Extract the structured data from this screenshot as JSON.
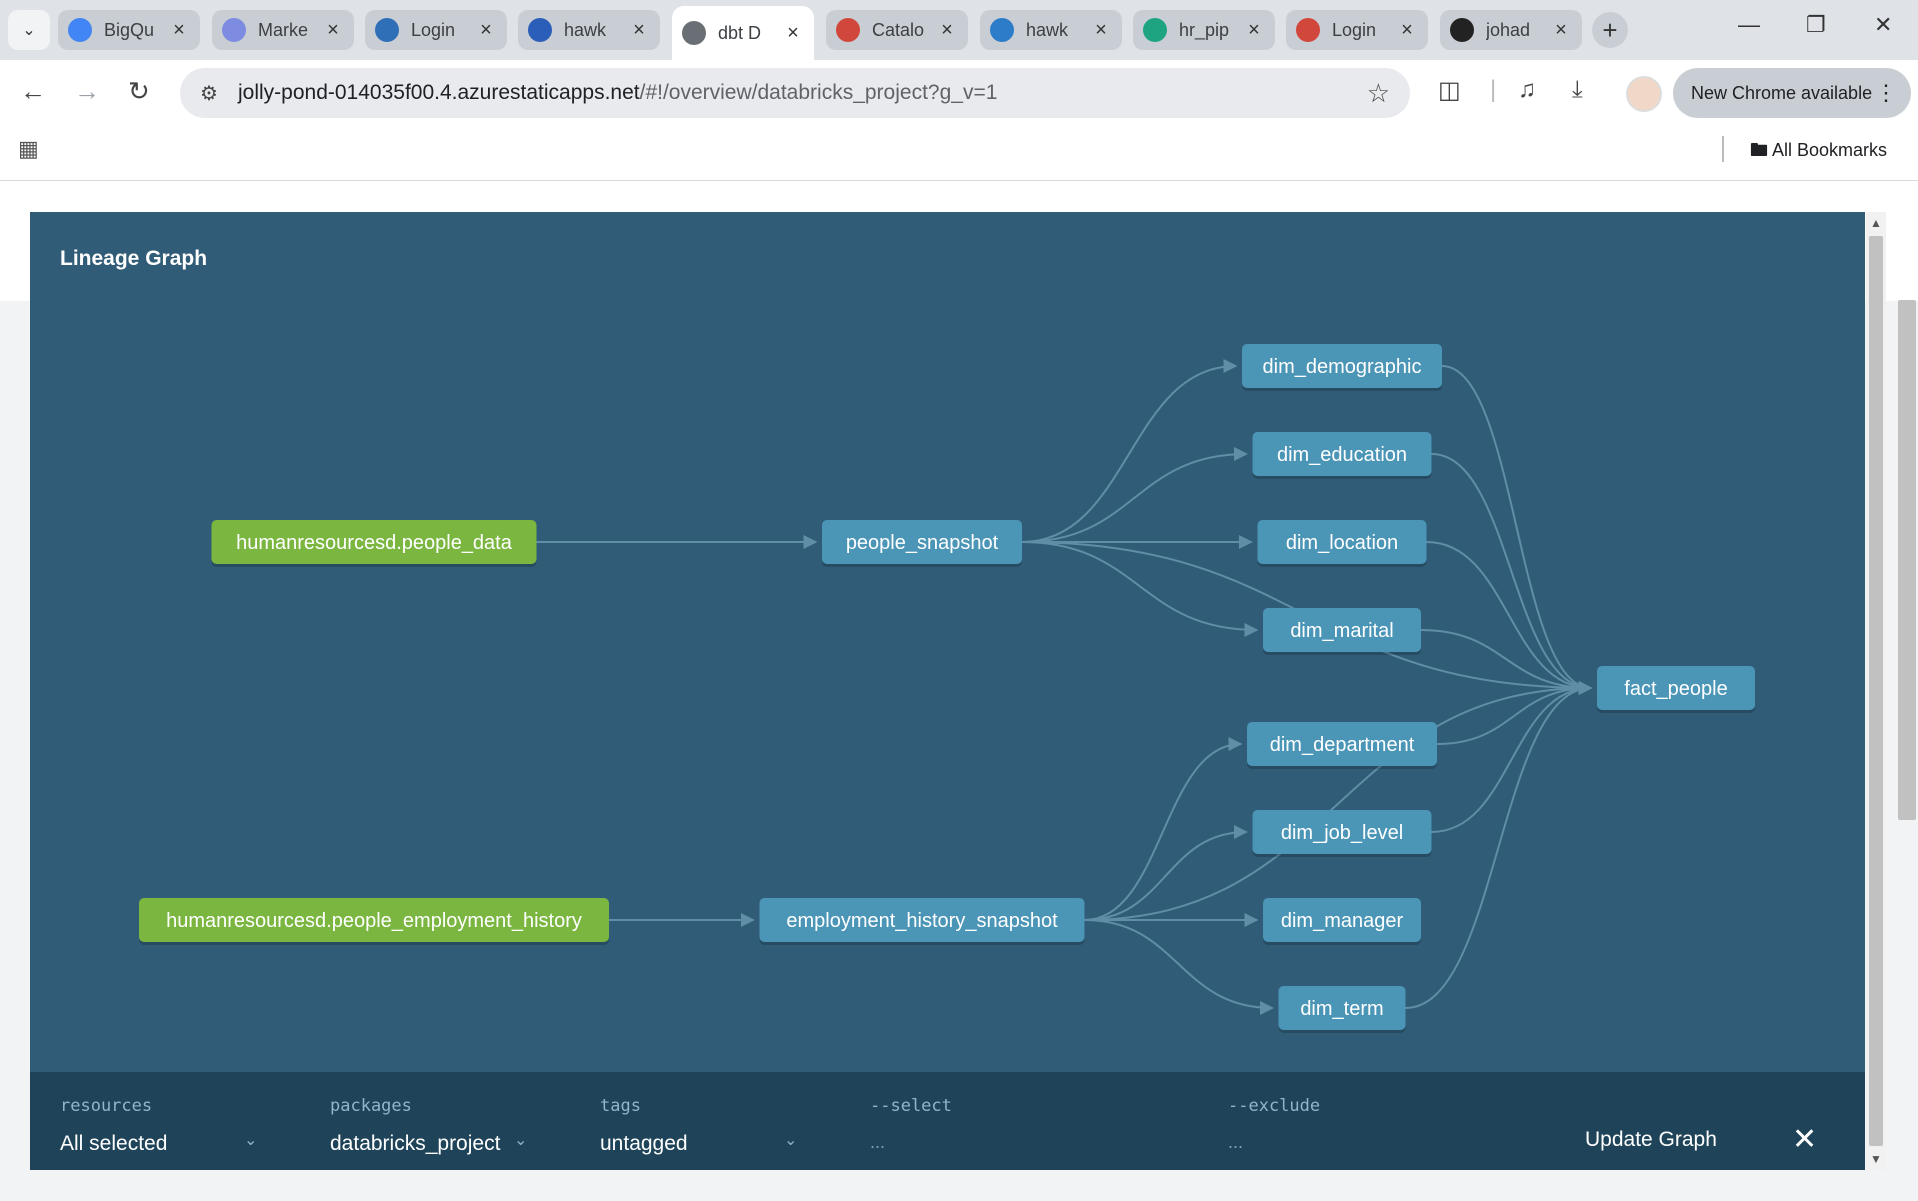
{
  "browser": {
    "tabs": [
      {
        "title": "BigQu",
        "icon": "bigquery-icon",
        "color": "#4285f4",
        "active": false
      },
      {
        "title": "Marke",
        "icon": "marketplace-icon",
        "color": "#7d8ce0",
        "active": false
      },
      {
        "title": "Login",
        "icon": "login-icon",
        "color": "#2f6fb7",
        "active": false
      },
      {
        "title": "hawk",
        "icon": "azure-icon",
        "color": "#2b5eb8",
        "active": false
      },
      {
        "title": "dbt D",
        "icon": "globe-icon",
        "color": "#6a6f75",
        "active": true
      },
      {
        "title": "Catalo",
        "icon": "databricks-icon",
        "color": "#d2473b",
        "active": false
      },
      {
        "title": "hawk",
        "icon": "synapse-icon",
        "color": "#2d7cc9",
        "active": false
      },
      {
        "title": "hr_pip",
        "icon": "airflow-icon",
        "color": "#1ea47f",
        "active": false
      },
      {
        "title": "Login",
        "icon": "databricks-icon",
        "color": "#d2473b",
        "active": false
      },
      {
        "title": "johad",
        "icon": "github-icon",
        "color": "#222222",
        "active": false
      }
    ],
    "url_host": "jolly-pond-014035f00.4.azurestaticapps.net",
    "url_path": "/#!/overview/databricks_project?g_v=1",
    "new_chrome_label": "New Chrome available",
    "all_bookmarks_label": "All Bookmarks"
  },
  "modal": {
    "title": "Lineage Graph"
  },
  "graph": {
    "nodes": [
      {
        "id": "people_data",
        "label": "humanresourcesd.people_data",
        "kind": "source"
      },
      {
        "id": "employment_history",
        "label": "humanresourcesd.people_employment_history",
        "kind": "source"
      },
      {
        "id": "people_snapshot",
        "label": "people_snapshot",
        "kind": "model"
      },
      {
        "id": "employment_history_snapshot",
        "label": "employment_history_snapshot",
        "kind": "model"
      },
      {
        "id": "dim_demographic",
        "label": "dim_demographic",
        "kind": "model"
      },
      {
        "id": "dim_education",
        "label": "dim_education",
        "kind": "model"
      },
      {
        "id": "dim_location",
        "label": "dim_location",
        "kind": "model"
      },
      {
        "id": "dim_marital",
        "label": "dim_marital",
        "kind": "model"
      },
      {
        "id": "dim_department",
        "label": "dim_department",
        "kind": "model"
      },
      {
        "id": "dim_job_level",
        "label": "dim_job_level",
        "kind": "model"
      },
      {
        "id": "dim_manager",
        "label": "dim_manager",
        "kind": "model"
      },
      {
        "id": "dim_term",
        "label": "dim_term",
        "kind": "model"
      },
      {
        "id": "fact_people",
        "label": "fact_people",
        "kind": "model"
      }
    ],
    "edges": [
      [
        "people_data",
        "people_snapshot"
      ],
      [
        "employment_history",
        "employment_history_snapshot"
      ],
      [
        "people_snapshot",
        "dim_demographic"
      ],
      [
        "people_snapshot",
        "dim_education"
      ],
      [
        "people_snapshot",
        "dim_location"
      ],
      [
        "people_snapshot",
        "dim_marital"
      ],
      [
        "people_snapshot",
        "fact_people"
      ],
      [
        "employment_history_snapshot",
        "dim_department"
      ],
      [
        "employment_history_snapshot",
        "dim_job_level"
      ],
      [
        "employment_history_snapshot",
        "dim_manager"
      ],
      [
        "employment_history_snapshot",
        "dim_term"
      ],
      [
        "employment_history_snapshot",
        "fact_people"
      ],
      [
        "dim_demographic",
        "fact_people"
      ],
      [
        "dim_education",
        "fact_people"
      ],
      [
        "dim_location",
        "fact_people"
      ],
      [
        "dim_marital",
        "fact_people"
      ],
      [
        "dim_department",
        "fact_people"
      ],
      [
        "dim_job_level",
        "fact_people"
      ],
      [
        "dim_term",
        "fact_people"
      ]
    ],
    "colors": {
      "source": "#7ab640",
      "model": "#4b95b7",
      "edge": "#5f8ea6",
      "background": "#305c77"
    }
  },
  "filters": {
    "resources": {
      "label": "resources",
      "value": "All selected"
    },
    "packages": {
      "label": "packages",
      "value": "databricks_project"
    },
    "tags": {
      "label": "tags",
      "value": "untagged"
    },
    "select": {
      "label": "--select",
      "value": "..."
    },
    "exclude": {
      "label": "--exclude",
      "value": "..."
    },
    "update_label": "Update Graph"
  }
}
